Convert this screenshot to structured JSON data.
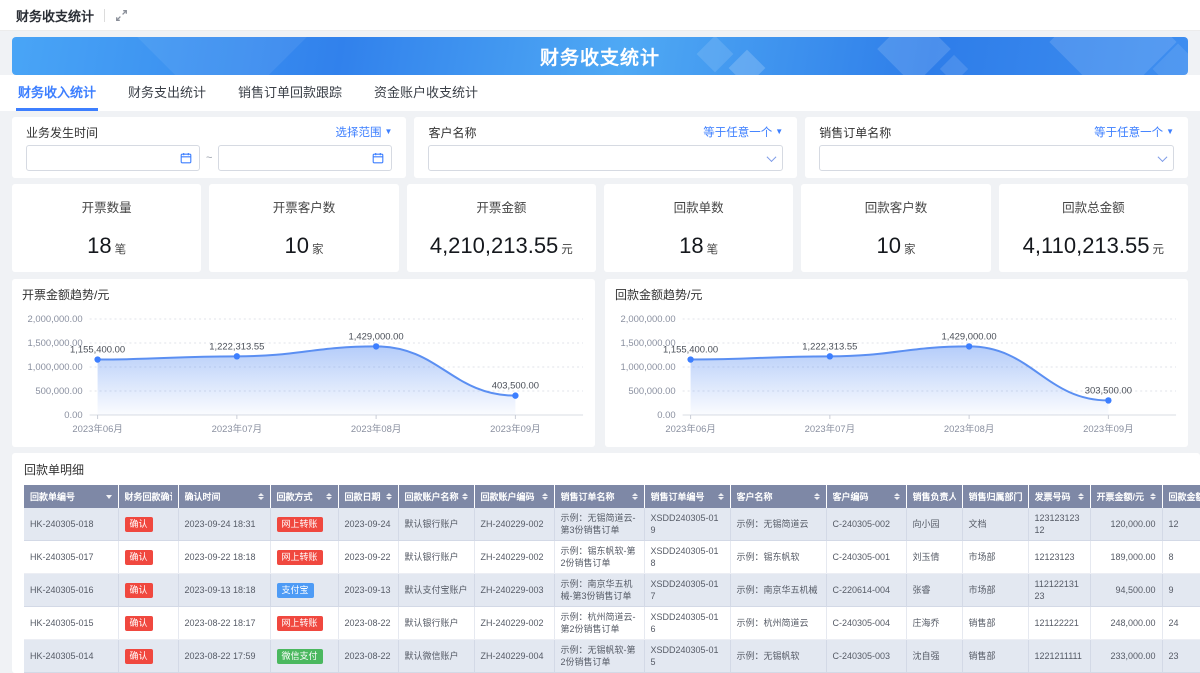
{
  "topbar": {
    "title": "财务收支统计"
  },
  "banner": {
    "title": "财务收支统计"
  },
  "tabs": [
    {
      "label": "财务收入统计",
      "active": true
    },
    {
      "label": "财务支出统计",
      "active": false
    },
    {
      "label": "销售订单回款跟踪",
      "active": false
    },
    {
      "label": "资金账户收支统计",
      "active": false
    }
  ],
  "filters": {
    "time": {
      "label": "业务发生时间",
      "operator": "选择范围",
      "separator": "~",
      "start_value": "",
      "end_value": ""
    },
    "customer": {
      "label": "客户名称",
      "operator": "等于任意一个",
      "value": ""
    },
    "order": {
      "label": "销售订单名称",
      "operator": "等于任意一个",
      "value": ""
    }
  },
  "stats": [
    {
      "label": "开票数量",
      "value": "18",
      "unit": "笔"
    },
    {
      "label": "开票客户数",
      "value": "10",
      "unit": "家"
    },
    {
      "label": "开票金额",
      "value": "4,210,213.55",
      "unit": "元"
    },
    {
      "label": "回款单数",
      "value": "18",
      "unit": "笔"
    },
    {
      "label": "回款客户数",
      "value": "10",
      "unit": "家"
    },
    {
      "label": "回款总金额",
      "value": "4,110,213.55",
      "unit": "元"
    }
  ],
  "chart_data": [
    {
      "type": "area",
      "title": "开票金额趋势/元",
      "x": [
        "2023年06月",
        "2023年07月",
        "2023年08月",
        "2023年09月"
      ],
      "values": [
        1155400,
        1222313.55,
        1429000,
        403500
      ],
      "point_labels": [
        "1,155,400.00",
        "1,222,313.55",
        "1,429,000.00",
        "403,500.00"
      ],
      "ylim": [
        0,
        2000000
      ],
      "yticks": {
        "values": [
          0,
          500000,
          1000000,
          1500000,
          2000000
        ],
        "labels": [
          "0.00",
          "500,000.00",
          "1,000,000.00",
          "1,500,000.00",
          "2,000,000.00"
        ]
      },
      "grid": "dotted-horizontal",
      "legend": "none",
      "line_color": "#5B8FF2",
      "point_color": "#3D7FFF"
    },
    {
      "type": "area",
      "title": "回款金额趋势/元",
      "x": [
        "2023年06月",
        "2023年07月",
        "2023年08月",
        "2023年09月"
      ],
      "values": [
        1155400,
        1222313.55,
        1429000,
        303500
      ],
      "point_labels": [
        "1,155,400.00",
        "1,222,313.55",
        "1,429,000.00",
        "303,500.00"
      ],
      "ylim": [
        0,
        2000000
      ],
      "yticks": {
        "values": [
          0,
          500000,
          1000000,
          1500000,
          2000000
        ],
        "labels": [
          "0.00",
          "500,000.00",
          "1,000,000.00",
          "1,500,000.00",
          "2,000,000.00"
        ]
      },
      "grid": "dotted-horizontal",
      "legend": "none",
      "line_color": "#5B8FF2",
      "point_color": "#3D7FFF"
    }
  ],
  "table": {
    "title": "回款单明细",
    "columns": [
      {
        "label": "回款单编号",
        "icon": "filter"
      },
      {
        "label": "财务回款确认",
        "icon": "sort"
      },
      {
        "label": "确认时间",
        "icon": "sort"
      },
      {
        "label": "回款方式",
        "icon": "sort"
      },
      {
        "label": "回款日期",
        "icon": "sort"
      },
      {
        "label": "回款账户名称",
        "icon": "sort"
      },
      {
        "label": "回款账户编码",
        "icon": "sort"
      },
      {
        "label": "销售订单名称",
        "icon": "sort"
      },
      {
        "label": "销售订单编号",
        "icon": "sort"
      },
      {
        "label": "客户名称",
        "icon": "sort"
      },
      {
        "label": "客户编码",
        "icon": "sort"
      },
      {
        "label": "销售负责人",
        "icon": "sort"
      },
      {
        "label": "销售归属部门",
        "icon": "sort"
      },
      {
        "label": "发票号码",
        "icon": "sort"
      },
      {
        "label": "开票金额/元",
        "icon": "sort"
      },
      {
        "label": "回款金额/元",
        "icon": "sort"
      }
    ],
    "rows": [
      {
        "id": "HK-240305-018",
        "confirm": "确认",
        "time": "2023-09-24 18:31",
        "method": "网上转账",
        "method_color": "red",
        "date": "2023-09-24",
        "acct_name": "默认银行账户",
        "acct_code": "ZH-240229-002",
        "order_name": "示例：无锡简道云-第3份销售订单",
        "order_code": "XSDD240305-019",
        "customer": "示例：无锡简道云",
        "cust_code": "C-240305-002",
        "person": "向小园",
        "dept": "文档",
        "invoice_no": "12312312312",
        "inv_amt": "120,000.00",
        "pay_amt": "12"
      },
      {
        "id": "HK-240305-017",
        "confirm": "确认",
        "time": "2023-09-22 18:18",
        "method": "网上转账",
        "method_color": "red",
        "date": "2023-09-22",
        "acct_name": "默认银行账户",
        "acct_code": "ZH-240229-002",
        "order_name": "示例：锡东帆软-第2份销售订单",
        "order_code": "XSDD240305-018",
        "customer": "示例：锡东帆软",
        "cust_code": "C-240305-001",
        "person": "刘玉倩",
        "dept": "市场部",
        "invoice_no": "12123123",
        "inv_amt": "189,000.00",
        "pay_amt": "8"
      },
      {
        "id": "HK-240305-016",
        "confirm": "确认",
        "time": "2023-09-13 18:18",
        "method": "支付宝",
        "method_color": "blue",
        "date": "2023-09-13",
        "acct_name": "默认支付宝账户",
        "acct_code": "ZH-240229-003",
        "order_name": "示例：南京华五机械-第3份销售订单",
        "order_code": "XSDD240305-017",
        "customer": "示例：南京华五机械",
        "cust_code": "C-220614-004",
        "person": "张睿",
        "dept": "市场部",
        "invoice_no": "11212213123",
        "inv_amt": "94,500.00",
        "pay_amt": "9"
      },
      {
        "id": "HK-240305-015",
        "confirm": "确认",
        "time": "2023-08-22 18:17",
        "method": "网上转账",
        "method_color": "red",
        "date": "2023-08-22",
        "acct_name": "默认银行账户",
        "acct_code": "ZH-240229-002",
        "order_name": "示例：杭州简道云-第2份销售订单",
        "order_code": "XSDD240305-016",
        "customer": "示例：杭州简道云",
        "cust_code": "C-240305-004",
        "person": "庄海乔",
        "dept": "销售部",
        "invoice_no": "121122221",
        "inv_amt": "248,000.00",
        "pay_amt": "24"
      },
      {
        "id": "HK-240305-014",
        "confirm": "确认",
        "time": "2023-08-22 17:59",
        "method": "微信支付",
        "method_color": "green",
        "date": "2023-08-22",
        "acct_name": "默认微信账户",
        "acct_code": "ZH-240229-004",
        "order_name": "示例：无锡帆软-第2份销售订单",
        "order_code": "XSDD240305-015",
        "customer": "示例：无锡帆软",
        "cust_code": "C-240305-003",
        "person": "沈自强",
        "dept": "销售部",
        "invoice_no": "1221211111",
        "inv_amt": "233,000.00",
        "pay_amt": "23"
      }
    ]
  },
  "colors": {
    "accent": "#3D7FFF",
    "badge_red": "#F0483F",
    "badge_blue": "#4E9BF5",
    "badge_green": "#4BB85F",
    "table_header_bg": "#7E88A6",
    "table_stripe": "#E3E8F1",
    "chart_line": "#5B8FF2"
  }
}
